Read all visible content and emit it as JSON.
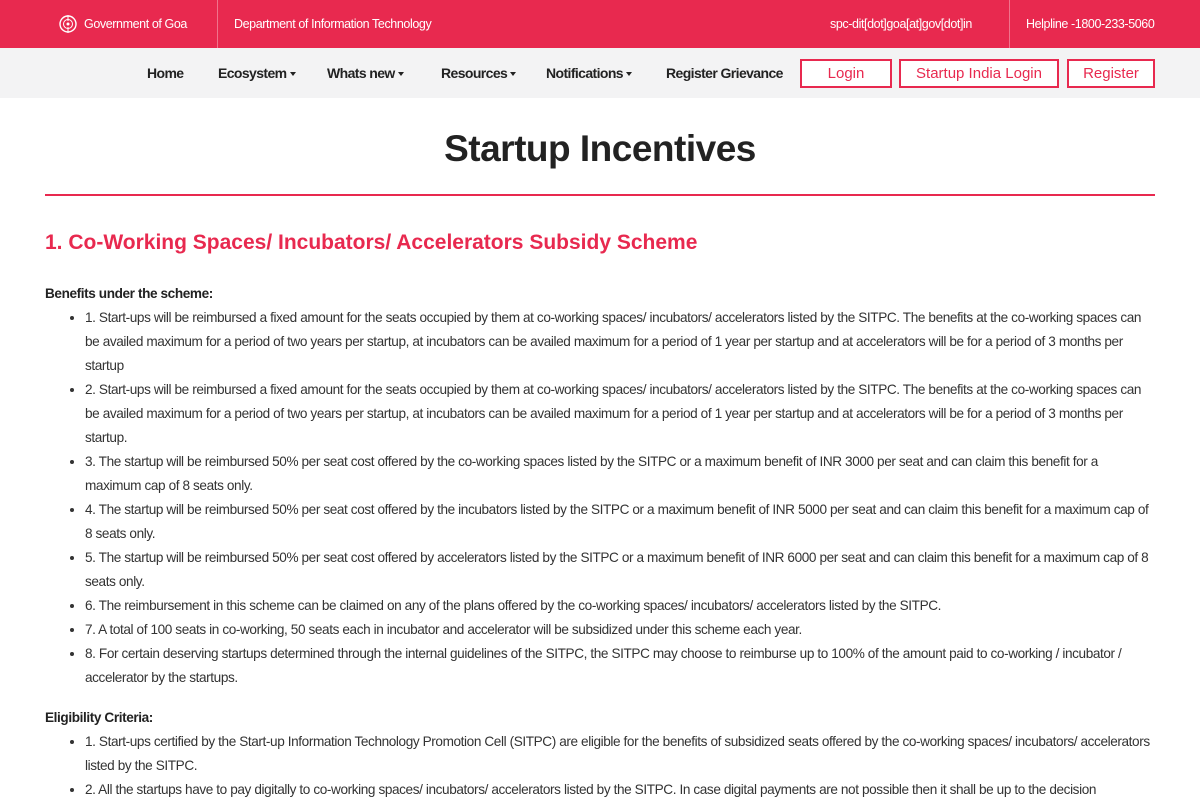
{
  "topbar": {
    "government": "Government of Goa",
    "department": "Department of Information Technology",
    "email": "spc-dit[dot]goa[at]gov[dot]in",
    "helpline": "Helpline -1800-233-5060"
  },
  "nav": {
    "home": "Home",
    "ecosystem": "Ecosystem",
    "whats_new": "Whats new",
    "resources": "Resources",
    "notifications": "Notifications",
    "register_grievance": "Register Grievance",
    "login": "Login",
    "startup_india_login": "Startup India Login",
    "register": "Register"
  },
  "page": {
    "title": "Startup Incentives",
    "section_heading": "1. Co-Working Spaces/ Incubators/ Accelerators Subsidy Scheme",
    "benefits_heading": "Benefits under the scheme:",
    "benefits": [
      "1. Start-ups will be reimbursed a fixed amount for the seats occupied by them at co-working spaces/ incubators/ accelerators listed by the SITPC. The benefits at the co-working spaces can be availed maximum for a period of two years per startup, at incubators can be availed maximum for a period of 1 year per startup and at accelerators will be for a period of 3 months per startup",
      "2. Start-ups will be reimbursed a fixed amount for the seats occupied by them at co-working spaces/ incubators/ accelerators listed by the SITPC. The benefits at the co-working spaces can be availed maximum for a period of two years per startup, at incubators can be availed maximum for a period of 1 year per startup and at accelerators will be for a period of 3 months per startup.",
      "3. The startup will be reimbursed 50% per seat cost offered by the co-working spaces listed by the SITPC or a maximum benefit of INR 3000 per seat and can claim this benefit for a maximum cap of 8 seats only.",
      "4. The startup will be reimbursed 50% per seat cost offered by the incubators listed by the SITPC or a maximum benefit of INR 5000 per seat and can claim this benefit for a maximum cap of 8 seats only.",
      "5. The startup will be reimbursed 50% per seat cost offered by accelerators listed by the SITPC or a maximum benefit of INR 6000 per seat and can claim this benefit for a maximum cap of 8 seats only.",
      "6. The reimbursement in this scheme can be claimed on any of the plans offered by the co-working spaces/ incubators/ accelerators listed by the SITPC.",
      "7. A total of 100 seats in co-working, 50 seats each in incubator and accelerator will be subsidized under this scheme each year.",
      "8. For certain deserving startups determined through the internal guidelines of the SITPC, the SITPC may choose to reimburse up to 100% of the amount paid to co-working / incubator / accelerator by the startups."
    ],
    "eligibility_heading": "Eligibility Criteria:",
    "eligibility": [
      "1. Start-ups certified by the Start-up Information Technology Promotion Cell (SITPC) are eligible for the benefits of subsidized seats offered by the co-working spaces/ incubators/ accelerators listed by the SITPC.",
      "2. All the startups have to pay digitally to co-working spaces/ incubators/ accelerators listed by the SITPC. In case digital payments are not possible then it shall be up to the decision"
    ]
  },
  "colors": {
    "accent": "#e8294f",
    "nav_bg": "#f3f3f4"
  }
}
